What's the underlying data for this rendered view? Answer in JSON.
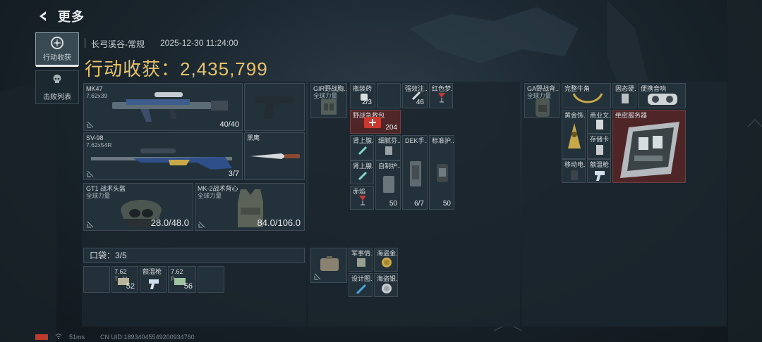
{
  "header": {
    "title": "更多"
  },
  "tabs": [
    {
      "label": "行动收获",
      "icon": "target-icon",
      "active": true
    },
    {
      "label": "击败列表",
      "icon": "skull-icon",
      "active": false
    }
  ],
  "raid": {
    "map": "长弓溪谷-常规",
    "datetime": "2025-12-30 11:24:00",
    "earnings_label": "行动收获：",
    "earnings_value": "2,435,799"
  },
  "gear": {
    "primary": {
      "name": "MK47",
      "sub": "7.62x39",
      "count": "40/40"
    },
    "sidearm": {
      "name": "",
      "sub": "",
      "count": ""
    },
    "secondary": {
      "name": "SV-98",
      "sub": "7.62x54R",
      "count": "3/7"
    },
    "melee": {
      "name": "黑鹰",
      "sub": "",
      "count": ""
    },
    "helmet": {
      "name": "GT1 战术头盔",
      "sub": "全球力量",
      "count": "28.0/48.0"
    },
    "armor": {
      "name": "MK-2战术背心",
      "sub": "全球力量",
      "count": "84.0/106.0"
    }
  },
  "pocket": {
    "label": "口袋：3/5",
    "items": [
      {
        "name": "",
        "sub": "",
        "count": ""
      },
      {
        "name": "7.62",
        "sub": "T...M",
        "count": "52"
      },
      {
        "name": "额温枪",
        "sub": "",
        "count": ""
      },
      {
        "name": "7.62",
        "sub": "P...",
        "count": "56"
      },
      {
        "name": "",
        "sub": "",
        "count": ""
      }
    ]
  },
  "rig": {
    "name": "GIR野战胸...",
    "sub": "全球力量",
    "items": {
      "pills": {
        "name": "瓶装药",
        "count": "2/3"
      },
      "injector": {
        "name": "强效注...",
        "count": "46"
      },
      "redwine": {
        "name": "红色梦..."
      },
      "firstaid": {
        "name": "野战急救包",
        "count": "204"
      },
      "backadrenaline1": {
        "name": "肾上腺..."
      },
      "stone": {
        "name": "细腻芬..."
      },
      "dek": {
        "name": "DEK手...",
        "count": "6/7"
      },
      "armorplate": {
        "name": "标准护...",
        "count": "50"
      },
      "backadrenaline2": {
        "name": "肾上腺..."
      },
      "homemade": {
        "name": "自制护...",
        "count": "50"
      },
      "redflame": {
        "name": "赤焰"
      }
    }
  },
  "case": {
    "items": {
      "military": {
        "name": "军事情..."
      },
      "pirategold": {
        "name": "海盗金..."
      },
      "design": {
        "name": "设计图..."
      },
      "piratesilver": {
        "name": "海盗银..."
      }
    }
  },
  "backpack": {
    "name": "GA野战背...",
    "sub": "全球力量",
    "items": {
      "horn": {
        "name": "完整牛角"
      },
      "drive": {
        "name": "固态硬..."
      },
      "portable": {
        "name": "便携音响"
      },
      "goldstatue": {
        "name": "黄金饰..."
      },
      "commerce": {
        "name": "商业文..."
      },
      "server": {
        "name": "绝密服务器"
      },
      "storagecard": {
        "name": "存储卡"
      },
      "mobile": {
        "name": "移动电..."
      },
      "thermo": {
        "name": "额温枪"
      }
    }
  },
  "status": {
    "ping": "51ms",
    "uid": "CN UID:18934045549200934760"
  },
  "colors": {
    "gold": "#e8c36a",
    "red_cell": "#56262a",
    "accent": "#e6e8e8"
  }
}
